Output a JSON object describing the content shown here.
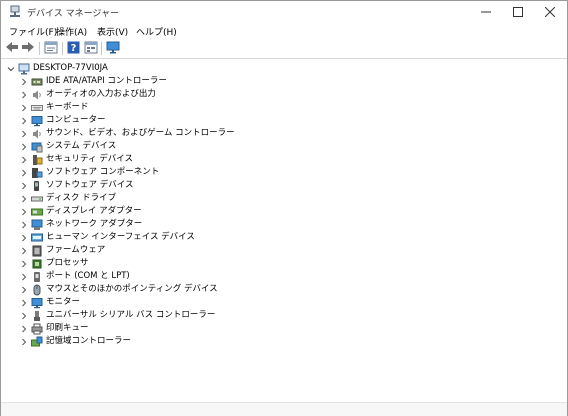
{
  "window": {
    "title": "デバイス マネージャー"
  },
  "menubar": {
    "items": [
      "ファイル(F)",
      "操作(A)",
      "表示(V)",
      "ヘルプ(H)"
    ]
  },
  "toolbar": {
    "buttons": [
      "back-icon",
      "forward-icon",
      "properties-icon",
      "help-icon",
      "details-icon",
      "monitor-icon"
    ]
  },
  "tree": {
    "root": {
      "label": "DESKTOP-77VI0JA",
      "icon": "computer-icon",
      "expanded": true
    },
    "categories": [
      {
        "label": "IDE ATA/ATAPI コントローラー",
        "icon": "ide-controller-icon"
      },
      {
        "label": "オーディオの入力および出力",
        "icon": "speaker-icon"
      },
      {
        "label": "キーボード",
        "icon": "keyboard-icon"
      },
      {
        "label": "コンピューター",
        "icon": "computer-monitor-icon"
      },
      {
        "label": "サウンド、ビデオ、およびゲーム コントローラー",
        "icon": "speaker-icon"
      },
      {
        "label": "システム デバイス",
        "icon": "system-device-icon"
      },
      {
        "label": "セキュリティ デバイス",
        "icon": "security-icon"
      },
      {
        "label": "ソフトウェア コンポーネント",
        "icon": "software-component-icon"
      },
      {
        "label": "ソフトウェア デバイス",
        "icon": "software-device-icon"
      },
      {
        "label": "ディスク ドライブ",
        "icon": "disk-drive-icon"
      },
      {
        "label": "ディスプレイ アダプター",
        "icon": "display-adapter-icon"
      },
      {
        "label": "ネットワーク アダプター",
        "icon": "network-adapter-icon"
      },
      {
        "label": "ヒューマン インターフェイス デバイス",
        "icon": "hid-icon"
      },
      {
        "label": "ファームウェア",
        "icon": "firmware-icon"
      },
      {
        "label": "プロセッサ",
        "icon": "processor-icon"
      },
      {
        "label": "ポート (COM と LPT)",
        "icon": "port-icon"
      },
      {
        "label": "マウスとそのほかのポインティング デバイス",
        "icon": "mouse-icon"
      },
      {
        "label": "モニター",
        "icon": "monitor-icon"
      },
      {
        "label": "ユニバーサル シリアル バス コントローラー",
        "icon": "usb-icon"
      },
      {
        "label": "印刷キュー",
        "icon": "printer-icon"
      },
      {
        "label": "記憶域コントローラー",
        "icon": "storage-controller-icon"
      }
    ]
  }
}
